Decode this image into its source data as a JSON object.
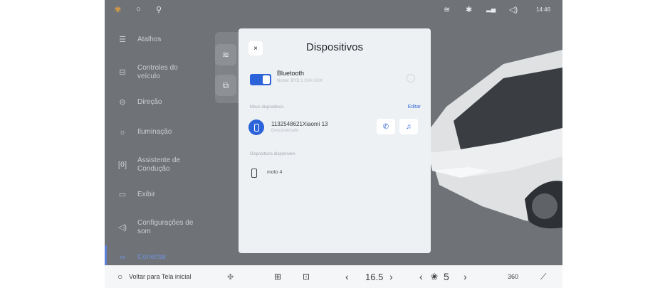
{
  "status_bar": {
    "time": "14:46",
    "left_icons": [
      "app-logo-icon",
      "circle-icon",
      "location-pin-icon"
    ],
    "right_icons": [
      "wifi-icon",
      "bluetooth-icon",
      "signal-icon",
      "volume-icon"
    ]
  },
  "sidebar": {
    "items": [
      {
        "label": "Atalhos",
        "icon": "shortcuts-icon"
      },
      {
        "label": "Controles do veículo",
        "icon": "car-controls-icon"
      },
      {
        "label": "Direção",
        "icon": "steering-icon"
      },
      {
        "label": "Iluminação",
        "icon": "light-icon"
      },
      {
        "label": "Assistente de Condução",
        "icon": "driver-assist-icon"
      },
      {
        "label": "Exibir",
        "icon": "display-icon"
      },
      {
        "label": "Configurações de som",
        "icon": "sound-icon"
      },
      {
        "label": "Conectar",
        "icon": "link-icon",
        "active": true
      }
    ]
  },
  "modal": {
    "title": "Dispositivos",
    "close": "×",
    "bluetooth": {
      "label": "Bluetooth",
      "subtitle": "Nome: BYD 1 XXX XXX",
      "enabled": true
    },
    "my_devices_header": "Meus dispositivos",
    "edit_label": "Editar",
    "paired_device": {
      "name": "1132548621Xiaomi 13",
      "status": "Desconectado"
    },
    "available_header": "Dispositivos disponíveis",
    "available_devices": [
      {
        "name": "moto 4"
      }
    ]
  },
  "bottom_bar": {
    "home_label": "Voltar para Tela inicial",
    "temperature": "16.5",
    "fan_level": "5",
    "camera_label": "360"
  },
  "colors": {
    "accent": "#2d63d8",
    "background": "#6f7377"
  }
}
